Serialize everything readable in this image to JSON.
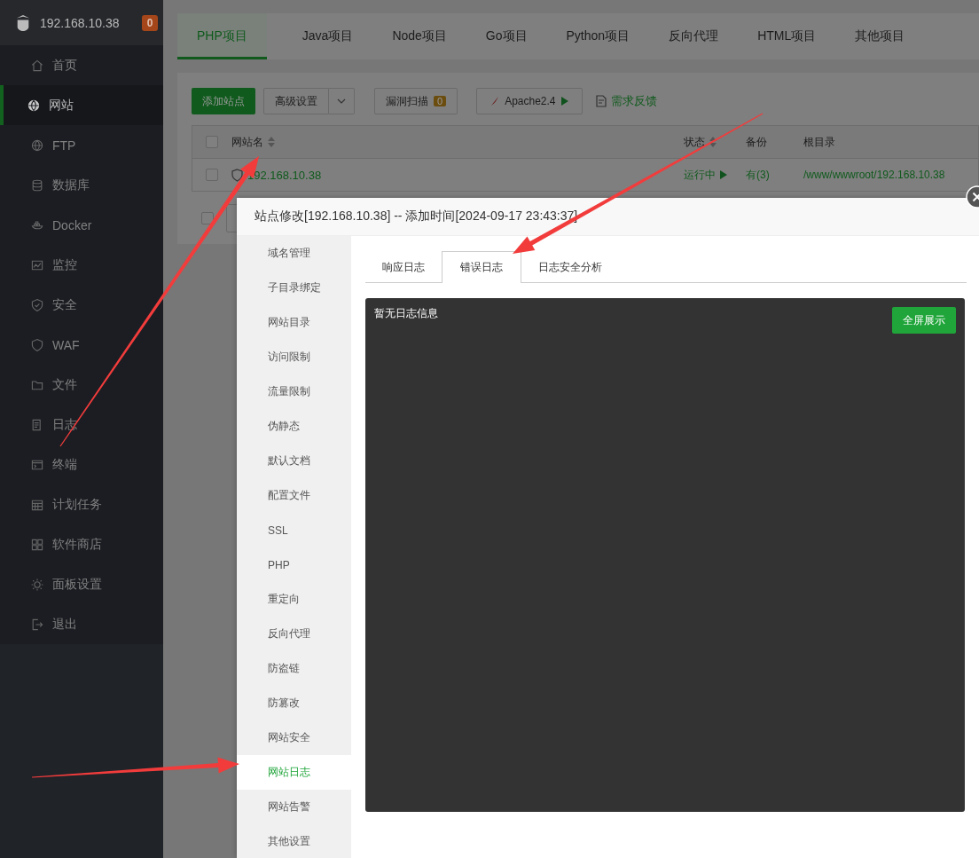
{
  "sidebar": {
    "host": "192.168.10.38",
    "badge": "0",
    "items": [
      {
        "label": "首页",
        "selected": false
      },
      {
        "label": "网站",
        "selected": true
      },
      {
        "label": "FTP",
        "selected": false
      },
      {
        "label": "数据库",
        "selected": false
      },
      {
        "label": "Docker",
        "selected": false
      },
      {
        "label": "监控",
        "selected": false
      },
      {
        "label": "安全",
        "selected": false
      },
      {
        "label": "WAF",
        "selected": false
      },
      {
        "label": "文件",
        "selected": false
      },
      {
        "label": "日志",
        "selected": false
      },
      {
        "label": "终端",
        "selected": false
      },
      {
        "label": "计划任务",
        "selected": false
      },
      {
        "label": "软件商店",
        "selected": false
      },
      {
        "label": "面板设置",
        "selected": false
      },
      {
        "label": "退出",
        "selected": false
      }
    ]
  },
  "tabs": [
    {
      "label": "PHP项目",
      "selected": true
    },
    {
      "label": "Java项目",
      "selected": false
    },
    {
      "label": "Node项目",
      "selected": false
    },
    {
      "label": "Go项目",
      "selected": false
    },
    {
      "label": "Python项目",
      "selected": false
    },
    {
      "label": "反向代理",
      "selected": false
    },
    {
      "label": "HTML项目",
      "selected": false
    },
    {
      "label": "其他项目",
      "selected": false
    }
  ],
  "toolbar": {
    "add_button": "添加站点",
    "advanced_button": "高级设置",
    "scan_button": "漏洞扫描",
    "scan_count": "0",
    "server_button": "Apache2.4",
    "feedback_link": "需求反馈"
  },
  "table": {
    "all_checked": false,
    "columns": [
      {
        "label": "网站名",
        "sortable": true
      },
      {
        "label": "状态",
        "sortable": true
      },
      {
        "label": "备份",
        "sortable": false
      },
      {
        "label": "根目录",
        "sortable": false
      }
    ],
    "rows": [
      {
        "checked": false,
        "name": "192.168.10.38",
        "status": "运行中",
        "backup": "有(3)",
        "root": "/www/wwwroot/192.168.10.38"
      }
    ],
    "footer_checked": false
  },
  "dialog": {
    "title": "站点修改[192.168.10.38] -- 添加时间[2024-09-17 23:43:37]",
    "menu": [
      {
        "label": "域名管理",
        "selected": false
      },
      {
        "label": "子目录绑定",
        "selected": false
      },
      {
        "label": "网站目录",
        "selected": false
      },
      {
        "label": "访问限制",
        "selected": false
      },
      {
        "label": "流量限制",
        "selected": false
      },
      {
        "label": "伪静态",
        "selected": false
      },
      {
        "label": "默认文档",
        "selected": false
      },
      {
        "label": "配置文件",
        "selected": false
      },
      {
        "label": "SSL",
        "selected": false
      },
      {
        "label": "PHP",
        "selected": false
      },
      {
        "label": "重定向",
        "selected": false
      },
      {
        "label": "反向代理",
        "selected": false
      },
      {
        "label": "防盗链",
        "selected": false
      },
      {
        "label": "防篡改",
        "selected": false
      },
      {
        "label": "网站安全",
        "selected": false
      },
      {
        "label": "网站日志",
        "selected": true
      },
      {
        "label": "网站告警",
        "selected": false
      },
      {
        "label": "其他设置",
        "selected": false
      }
    ],
    "log_tabs": [
      {
        "label": "响应日志",
        "selected": false
      },
      {
        "label": "错误日志",
        "selected": true
      },
      {
        "label": "日志安全分析",
        "selected": false
      }
    ],
    "log_text": "暂无日志信息",
    "fullscreen_button": "全屏展示"
  }
}
